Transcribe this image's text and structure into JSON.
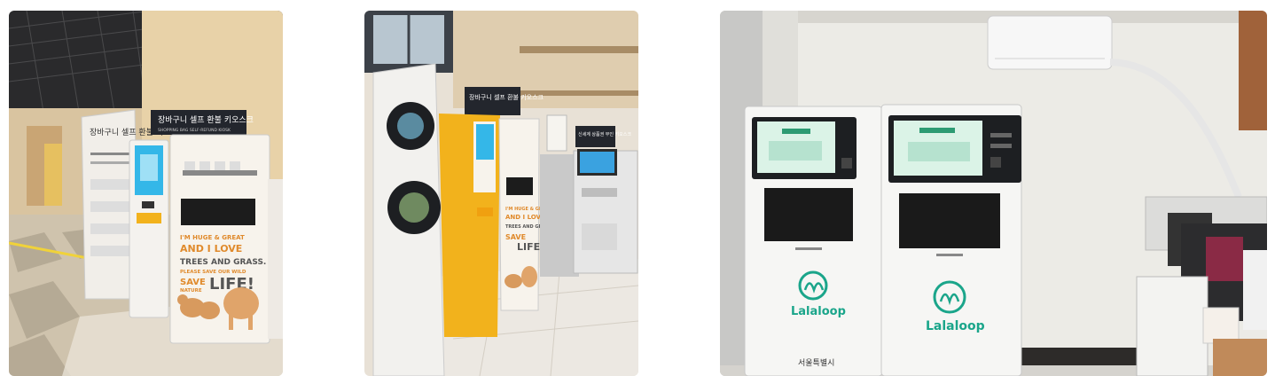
{
  "gallery": {
    "photos": [
      {
        "name": "kiosk-photo-department-store",
        "sign_korean": "장바구니 셀프 환불 키오스크",
        "sign_english": "SHOPPING BAG SELF-REFUND KIOSK",
        "standee_title": "장바구니 셀프 환불 키오스크",
        "slogan_line1": "I'M HUGE & GREAT",
        "slogan_line2": "AND I LOVE",
        "slogan_line3": "TREES AND GRASS.",
        "slogan_line4": "PLEASE SAVE OUR WILD",
        "slogan_line5": "SAVE",
        "slogan_line6": "NATURE",
        "slogan_line7": "LIFE!"
      },
      {
        "name": "kiosk-photo-shopping-mall",
        "sign_korean": "장바구니 셀프 환불 키오스크",
        "right_sign": "신세계 상품권 무인 키오스크",
        "slogan_line1": "I'M HUGE & GREAT",
        "slogan_line2": "AND I LOVE",
        "slogan_line3": "TREES AND GRASS",
        "slogan_line4": "SAVE",
        "slogan_line5": "LIFE!"
      },
      {
        "name": "kiosk-photo-lalaloop-room",
        "brand": "Lalaloop",
        "sponsor": "서울특별시"
      }
    ]
  },
  "colors": {
    "teal_brand": "#1aa58a",
    "kiosk_yellow": "#f2b21c",
    "orange_text": "#e08a2c",
    "dark_sign": "#23262d"
  }
}
